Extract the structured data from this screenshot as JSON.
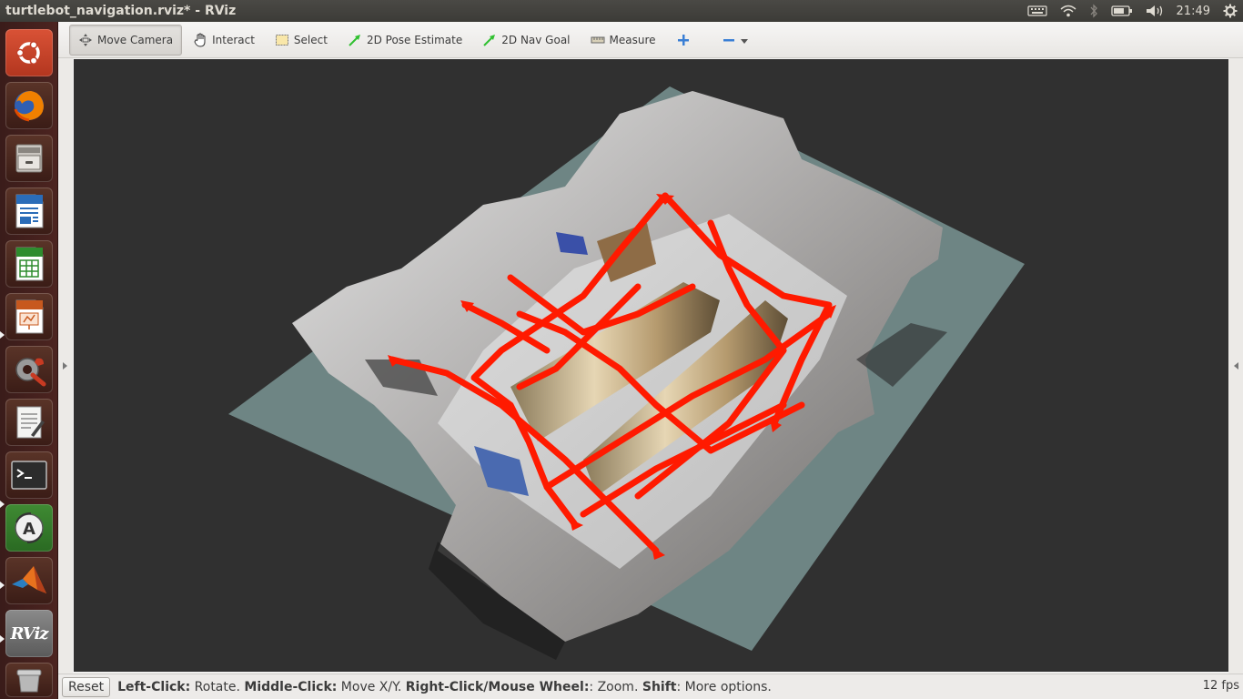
{
  "window": {
    "title": "turtlebot_navigation.rviz* - RViz"
  },
  "tray": {
    "time": "21:49",
    "icons": [
      "keyboard-icon",
      "wifi-icon",
      "bluetooth-icon",
      "battery-icon",
      "volume-icon",
      "settings-gear-icon"
    ]
  },
  "launcher": {
    "items": [
      {
        "name": "ubuntu-dash",
        "color": "#c2402a"
      },
      {
        "name": "firefox",
        "color": "#e66000"
      },
      {
        "name": "files",
        "color": "#8a8680"
      },
      {
        "name": "libreoffice-writer",
        "color": "#2a6cb8"
      },
      {
        "name": "libreoffice-calc",
        "color": "#2e8c2e"
      },
      {
        "name": "libreoffice-impress",
        "color": "#c7581e"
      },
      {
        "name": "system-settings",
        "color": "#8c8c8c"
      },
      {
        "name": "text-editor",
        "color": "#9a9a9a"
      },
      {
        "name": "terminal",
        "color": "#3a3a3a"
      },
      {
        "name": "software-updater",
        "color": "#4a9a3a"
      },
      {
        "name": "matlab",
        "color": "#c8501c"
      },
      {
        "name": "rviz",
        "color": "#707070",
        "label": "RViz"
      },
      {
        "name": "trash",
        "color": "#9a9a9a"
      }
    ]
  },
  "toolbar": {
    "tools": [
      {
        "id": "move-camera",
        "label": "Move Camera",
        "active": true
      },
      {
        "id": "interact",
        "label": "Interact"
      },
      {
        "id": "select",
        "label": "Select"
      },
      {
        "id": "pose-estimate",
        "label": "2D Pose Estimate"
      },
      {
        "id": "nav-goal",
        "label": "2D Nav Goal"
      },
      {
        "id": "measure",
        "label": "Measure"
      }
    ]
  },
  "statusbar": {
    "reset_label": "Reset",
    "help": [
      {
        "bold": "Left-Click:",
        "text": " Rotate. "
      },
      {
        "bold": "Middle-Click:",
        "text": " Move X/Y. "
      },
      {
        "bold": "Right-Click/Mouse Wheel:",
        "text": ": Zoom. "
      },
      {
        "bold": "Shift",
        "text": ": More options."
      }
    ],
    "fps": "12 fps"
  },
  "colors": {
    "viewport_bg": "#303030",
    "grid_plane": "#6e8584",
    "path_red": "#ff1a00",
    "launcher_bg": "#4c2420"
  }
}
